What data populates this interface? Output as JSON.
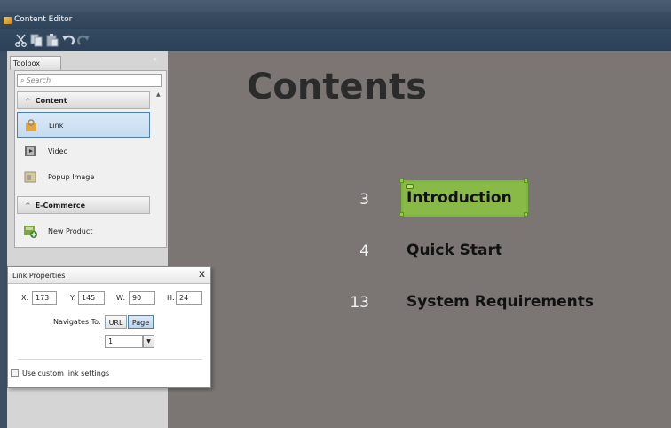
{
  "window": {
    "title": "Content Editor",
    "app_icon": "content-editor-icon"
  },
  "toolbar": {
    "buttons": [
      {
        "name": "cut-icon"
      },
      {
        "name": "copy-icon"
      },
      {
        "name": "paste-icon"
      },
      {
        "name": "undo-icon"
      },
      {
        "name": "redo-icon"
      }
    ]
  },
  "toolbox": {
    "tab_label": "Toolbox",
    "collapse_glyph": "«",
    "search_placeholder": "Search",
    "groups": [
      {
        "label": "Content",
        "items": [
          {
            "label": "Link",
            "icon": "link-icon",
            "selected": true
          },
          {
            "label": "Video",
            "icon": "video-icon"
          },
          {
            "label": "Popup Image",
            "icon": "popup-image-icon"
          }
        ]
      },
      {
        "label": "E-Commerce",
        "items": [
          {
            "label": "New Product",
            "icon": "new-product-icon"
          }
        ]
      }
    ]
  },
  "document": {
    "heading": "Contents",
    "entries": [
      {
        "page": "3",
        "title": "Introduction",
        "selected": true
      },
      {
        "page": "4",
        "title": "Quick Start"
      },
      {
        "page": "13",
        "title": "System Requirements"
      }
    ]
  },
  "link_properties": {
    "title": "Link Properties",
    "close_glyph": "X",
    "x_label": "X:",
    "x_value": "173",
    "y_label": "Y:",
    "y_value": "145",
    "w_label": "W:",
    "w_value": "90",
    "h_label": "H:",
    "h_value": "24",
    "navigates_label": "Navigates To:",
    "url_option": "URL",
    "page_option": "Page",
    "selected_option": "Page",
    "page_select_value": "1",
    "custom_settings_label": "Use custom link settings",
    "custom_settings_checked": false
  },
  "colors": {
    "accent_link_highlight": "#8cc63f",
    "selection_blue": "#4a7fae",
    "canvas_background": "#7b7673"
  }
}
